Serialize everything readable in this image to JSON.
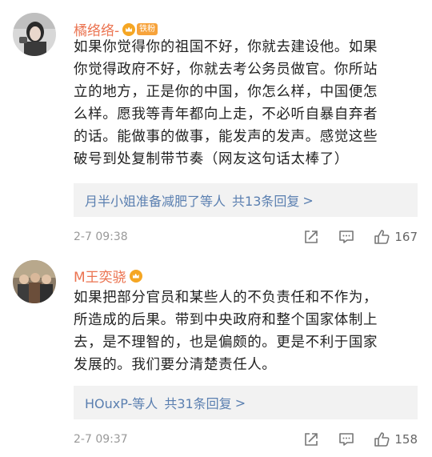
{
  "comments": [
    {
      "username": "橘络络-",
      "fan_badge": "铁粉",
      "avatar": "girl-photo-avatar",
      "lines": [
        "如果你觉得你的祖国不好，你就去建设他。如果",
        "你觉得政府不好，你就去考公务员做官。你所站",
        "立的地方，正是你的中国，你怎么样，中国便怎",
        "么样。愿我等青年都向上走，不必听自暴自弃者",
        "的话。能做事的做事，能发声的发声。感觉这些",
        "破号到处复制带节奏（网友这句话太棒了）"
      ],
      "reply_names": "月半小姐准备减肥了等人",
      "reply_count": "共13条回复",
      "reply_arrow": ">",
      "time": "2-7 09:38",
      "likes": "167"
    },
    {
      "username": "M王奕骁",
      "avatar": "group-photo-avatar",
      "lines": [
        "如果把部分官员和某些人的不负责任和不作为，",
        "所造成的后果。带到中央政府和整个国家体制上",
        "去，是不理智的，也是偏颇的。更是不利于国家",
        "发展的。我们要分清楚责任人。"
      ],
      "reply_names": "HOuxP-等人",
      "reply_count": "共31条回复",
      "reply_arrow": ">",
      "time": "2-7 09:37",
      "likes": "158"
    }
  ],
  "icons": {
    "share": "share-icon",
    "comment": "comment-icon",
    "like": "thumbs-up-icon"
  },
  "colors": {
    "username": "#eb7350",
    "link": "#5a7fb0",
    "muted": "#999999",
    "reply_bg": "#f2f2f2"
  }
}
